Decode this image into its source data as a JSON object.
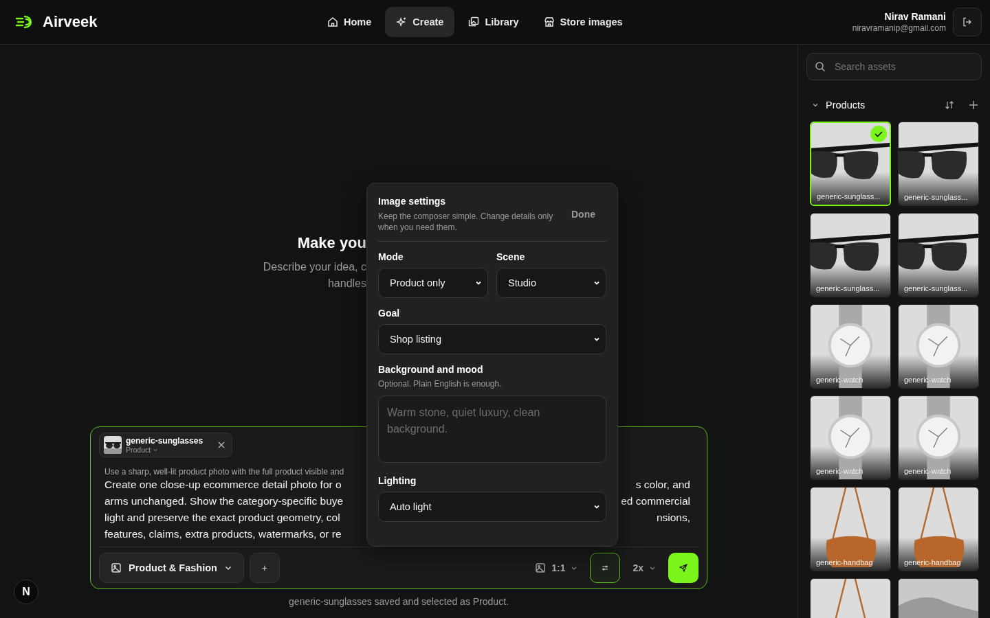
{
  "header": {
    "brand": "Airveek",
    "nav": [
      {
        "label": "Home",
        "kind": "home",
        "selected": false
      },
      {
        "label": "Create",
        "kind": "create",
        "selected": true
      },
      {
        "label": "Library",
        "kind": "library",
        "selected": false
      },
      {
        "label": "Store images",
        "kind": "store",
        "selected": false
      }
    ],
    "user": {
      "name": "Nirav Ramani",
      "email": "niravramanip@gmail.com"
    }
  },
  "hero": {
    "title": "Make you",
    "lines": [
      "Describe your idea, c",
      "handles"
    ]
  },
  "composer": {
    "attachment": {
      "name": "generic-sunglasses",
      "role": "Product"
    },
    "hint": "Use a sharp, well-lit product photo with the full product visible and",
    "prompt_lines": [
      {
        "left": "Create one close-up ecommerce detail photo for o",
        "right": "s color, and"
      },
      {
        "left": "arms unchanged. Show the category-specific buye",
        "right": "ed commercial"
      },
      {
        "left": "light and preserve the exact product geometry, col",
        "right": "nsions,"
      },
      {
        "left": "features, claims, extra products, watermarks, or re"
      }
    ],
    "category": "Product & Fashion",
    "add": "+",
    "aspect": "1:1",
    "settings_open": true,
    "scale": "2x"
  },
  "status": "generic-sunglasses saved and selected as Product.",
  "dev_badge": "N",
  "settings_panel": {
    "title": "Image settings",
    "description": "Keep the composer simple. Change details only when you need them.",
    "done": "Done",
    "mode": {
      "label": "Mode",
      "value": "Product only"
    },
    "scene": {
      "label": "Scene",
      "value": "Studio"
    },
    "goal": {
      "label": "Goal",
      "value": "Shop listing"
    },
    "background": {
      "label": "Background and mood",
      "hint": "Optional. Plain English is enough.",
      "placeholder": "Warm stone, quiet luxury, clean background."
    },
    "lighting": {
      "label": "Lighting",
      "value": "Auto light"
    }
  },
  "sidebar": {
    "search": {
      "placeholder": "Search assets"
    },
    "section": {
      "title": "Products",
      "expanded": true
    },
    "assets": [
      {
        "kind": "sunglasses",
        "label": "generic-sunglass...",
        "selected": true
      },
      {
        "kind": "sunglasses",
        "label": "generic-sunglass...",
        "selected": false
      },
      {
        "kind": "sunglasses",
        "label": "generic-sunglass...",
        "selected": false
      },
      {
        "kind": "sunglasses",
        "label": "generic-sunglass...",
        "selected": false
      },
      {
        "kind": "watch",
        "label": "generic-watch",
        "selected": false
      },
      {
        "kind": "watch",
        "label": "generic-watch",
        "selected": false
      },
      {
        "kind": "watch",
        "label": "generic-watch",
        "selected": false
      },
      {
        "kind": "watch",
        "label": "generic-watch",
        "selected": false
      },
      {
        "kind": "handbag",
        "label": "generic-handbag",
        "selected": false
      },
      {
        "kind": "handbag",
        "label": "generic-handbag",
        "selected": false
      },
      {
        "kind": "handbag",
        "selected": false
      },
      {
        "kind": "shoe",
        "selected": false
      }
    ]
  }
}
